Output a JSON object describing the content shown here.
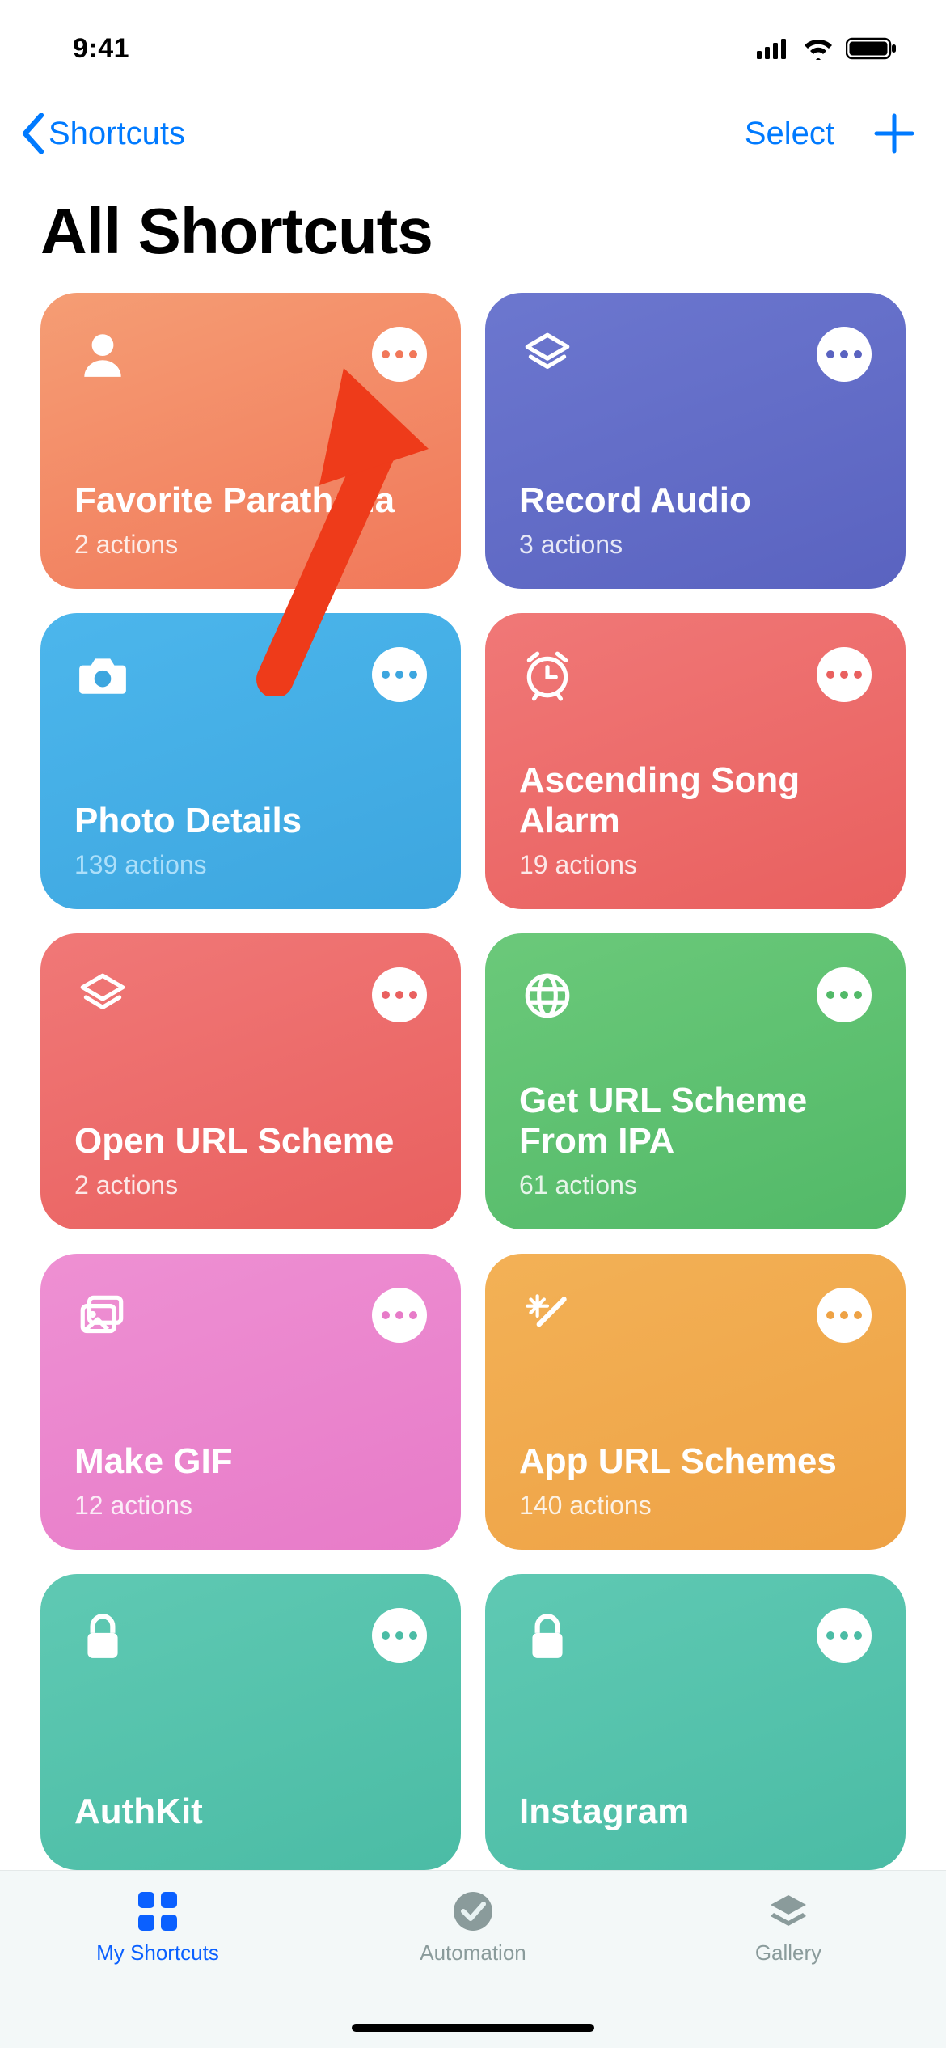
{
  "status": {
    "time": "9:41"
  },
  "nav": {
    "back_label": "Shortcuts",
    "select_label": "Select"
  },
  "page": {
    "title": "All Shortcuts"
  },
  "shortcuts": [
    {
      "icon": "person",
      "title": "Favorite Parathena",
      "sub": "2 actions",
      "bg": "linear-gradient(160deg,#f59d74,#f1785a)",
      "dot": "#f1785a"
    },
    {
      "icon": "layers",
      "title": "Record Audio",
      "sub": "3 actions",
      "bg": "linear-gradient(160deg,#6c77cf,#5a63c0)",
      "dot": "#5a63c0"
    },
    {
      "icon": "camera",
      "title": "Photo Details",
      "sub": "139 actions",
      "bg": "linear-gradient(160deg,#4cb6ec,#3da6df)",
      "dot": "#3da6df",
      "sub_color": "#bfe9ff"
    },
    {
      "icon": "alarm",
      "title": "Ascending Song Alarm",
      "sub": "19 actions",
      "bg": "linear-gradient(160deg,#f07877,#e9605f)",
      "dot": "#e9605f"
    },
    {
      "icon": "layers",
      "title": "Open URL Scheme",
      "sub": "2 actions",
      "bg": "linear-gradient(160deg,#f07877,#e9605f)",
      "dot": "#e9605f"
    },
    {
      "icon": "globe",
      "title": "Get URL Scheme From IPA",
      "sub": "61 actions",
      "bg": "linear-gradient(160deg,#6bc97a,#52b968)",
      "dot": "#52b968"
    },
    {
      "icon": "photos",
      "title": "Make GIF",
      "sub": "12 actions",
      "bg": "linear-gradient(160deg,#ee90d3,#e77bc8)",
      "dot": "#e77bc8"
    },
    {
      "icon": "wand",
      "title": "App URL Schemes",
      "sub": "140 actions",
      "bg": "linear-gradient(160deg,#f3b156,#eea245)",
      "dot": "#eea245"
    },
    {
      "icon": "lock",
      "title": "AuthKit",
      "sub": "",
      "bg": "linear-gradient(160deg,#5fc9b3,#4bbca5)",
      "dot": "#4bbca5"
    },
    {
      "icon": "lock",
      "title": "Instagram",
      "sub": "",
      "bg": "linear-gradient(160deg,#5fc9b3,#4bbca5)",
      "dot": "#4bbca5"
    }
  ],
  "tabs": {
    "my_shortcuts": "My Shortcuts",
    "automation": "Automation",
    "gallery": "Gallery"
  },
  "annotation": {
    "arrow_target": "shortcut-card-0-more"
  }
}
